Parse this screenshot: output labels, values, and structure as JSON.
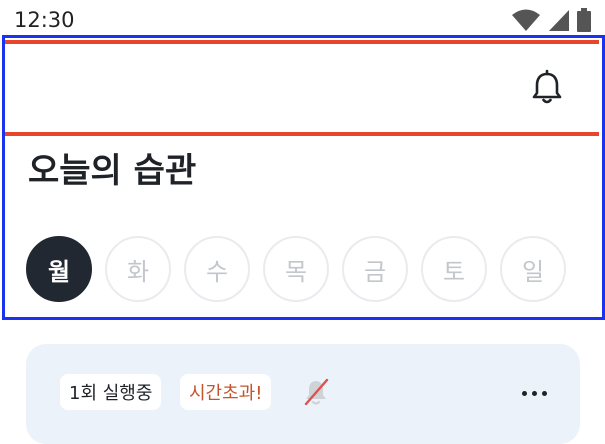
{
  "status_bar": {
    "time": "12:30",
    "icons": [
      "wifi-icon",
      "cellular-signal-icon",
      "battery-icon"
    ]
  },
  "header": {
    "notification_icon": "bell-icon"
  },
  "page": {
    "title": "오늘의 습관"
  },
  "weekdays": {
    "selected_index": 0,
    "items": [
      "월",
      "화",
      "수",
      "목",
      "금",
      "토",
      "일"
    ]
  },
  "habit_card": {
    "run_badge": "1회 실행중",
    "status_badge": "시간초과!",
    "alarm_icon": "bell-off-icon",
    "more_icon": "more-horizontal-icon"
  },
  "colors": {
    "annotation_outer": "#1b33f0",
    "annotation_inner": "#e8452e",
    "selected_day_bg": "#222831",
    "card_bg": "#ecf2fa",
    "overtime_text": "#c4542b"
  }
}
